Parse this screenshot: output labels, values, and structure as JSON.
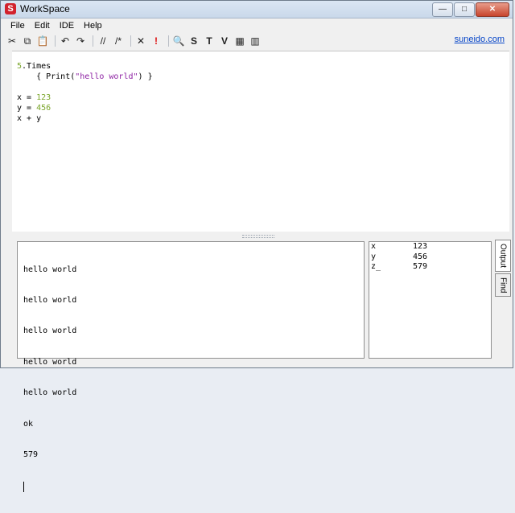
{
  "window": {
    "title": "WorkSpace"
  },
  "menubar": {
    "items": [
      "File",
      "Edit",
      "IDE",
      "Help"
    ]
  },
  "toolbar": {
    "icons": [
      "cut-icon",
      "copy-icon",
      "paste-icon",
      "undo-icon",
      "redo-icon",
      "comment-icon",
      "uncomment-icon",
      "clear-icon",
      "run-icon",
      "find-icon"
    ],
    "s_label": "S",
    "t_label": "T",
    "v_label": "V",
    "link": "suneido.com"
  },
  "editor": {
    "lines": [
      "5.Times",
      "    { Print(\"hello world\") }",
      "",
      "x = 123",
      "y = 456",
      "x + y"
    ]
  },
  "output": {
    "lines": [
      "hello world",
      "hello world",
      "hello world",
      "hello world",
      "hello world",
      "ok",
      "579"
    ]
  },
  "locals": {
    "rows": [
      {
        "name": "x",
        "value": "123"
      },
      {
        "name": "y",
        "value": "456"
      },
      {
        "name": "z_",
        "value": "579"
      }
    ]
  },
  "tabs": {
    "output": "Output",
    "find": "Find"
  }
}
